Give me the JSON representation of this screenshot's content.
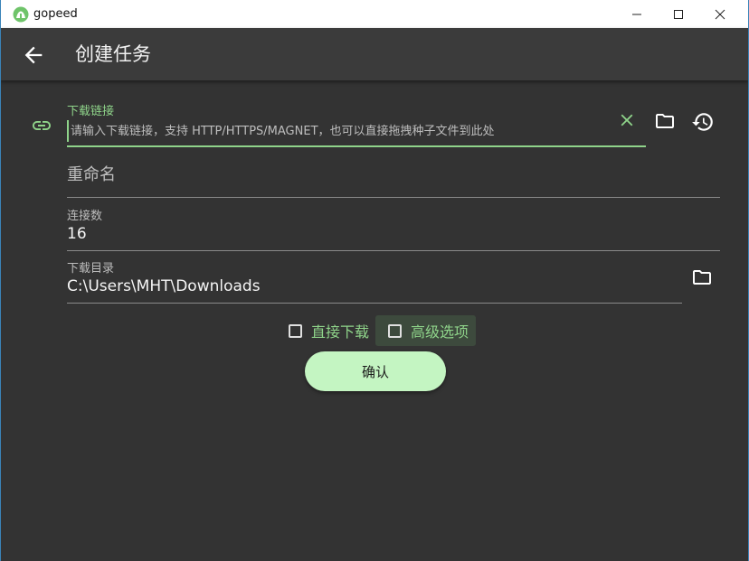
{
  "window": {
    "title": "gopeed",
    "controls": [
      "minimize",
      "maximize",
      "close"
    ]
  },
  "appbar": {
    "title": "创建任务",
    "back_icon": "arrow-left-icon"
  },
  "form": {
    "url": {
      "label": "下载链接",
      "placeholder": "请输入下载链接，支持 HTTP/HTTPS/MAGNET，也可以直接拖拽种子文件到此处",
      "value": ""
    },
    "rename": {
      "placeholder": "重命名"
    },
    "connections": {
      "label": "连接数",
      "value": "16"
    },
    "directory": {
      "label": "下载目录",
      "value": "C:\\Users\\MHT\\Downloads"
    },
    "options": {
      "direct_download": {
        "label": "直接下载",
        "checked": false
      },
      "advanced": {
        "label": "高级选项",
        "checked": false
      }
    },
    "confirm_label": "确认"
  },
  "colors": {
    "accent": "#8fd48a",
    "background": "#333333",
    "appbar": "#3b3b3b",
    "button": "#c4f5c2"
  }
}
